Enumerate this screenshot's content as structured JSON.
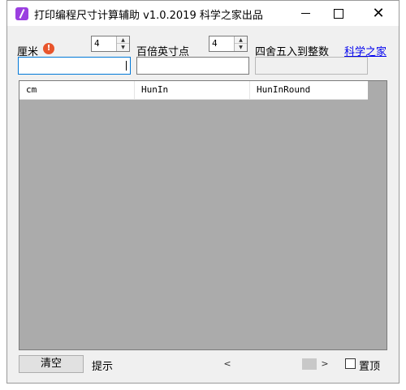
{
  "window": {
    "title": "打印编程尺寸计算辅助  v1.0.2019  科学之家出品",
    "minimize_icon": "minimize-icon",
    "maximize_icon": "maximize-icon",
    "close_icon": "close-icon"
  },
  "form": {
    "cm_label": "厘米",
    "cm_spin_value": "4",
    "hunin_label": "百倍英寸点",
    "hunin_spin_value": "4",
    "round_label": "四舍五入到整数",
    "link_label": "科学之家",
    "cm_input_value": "",
    "hunin_input_value": "",
    "round_input_value": ""
  },
  "list": {
    "columns": [
      "cm",
      "HunIn",
      "HunInRound"
    ],
    "rows": []
  },
  "footer": {
    "clear_label": "清空",
    "hint_label": "提示",
    "scroll_left": "<",
    "scroll_right": ">",
    "topmost_label": "置顶"
  }
}
